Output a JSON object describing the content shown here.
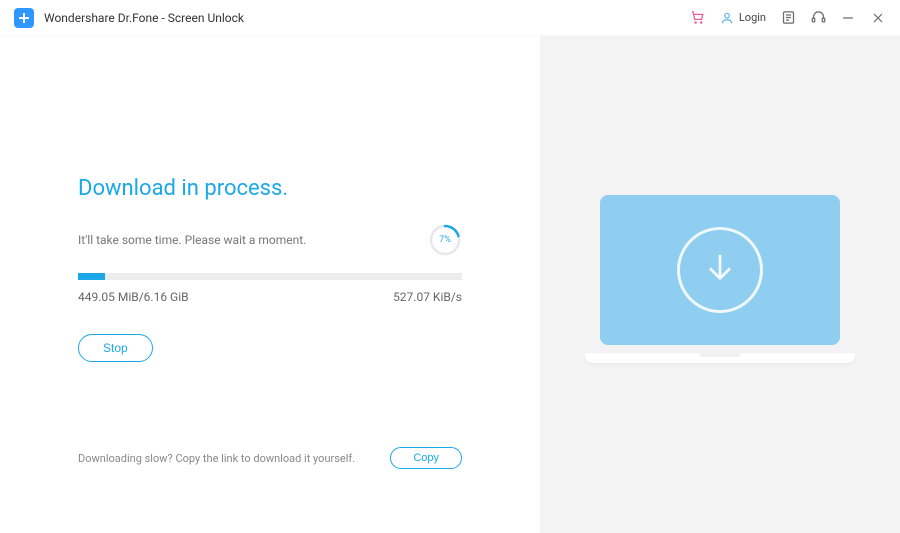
{
  "titlebar": {
    "app_title": "Wondershare Dr.Fone - Screen Unlock",
    "login_label": "Login"
  },
  "main": {
    "heading": "Download in process.",
    "subtext": "It'll take some time. Please wait a moment.",
    "progress_percent": 7,
    "progress_label": "7%",
    "downloaded": "449.05 MiB/6.16 GiB",
    "speed": "527.07 KiB/s",
    "stop_label": "Stop"
  },
  "footer": {
    "slow_text": "Downloading slow? Copy the link to download it yourself.",
    "copy_label": "Copy"
  },
  "colors": {
    "accent": "#1ba8e8"
  }
}
